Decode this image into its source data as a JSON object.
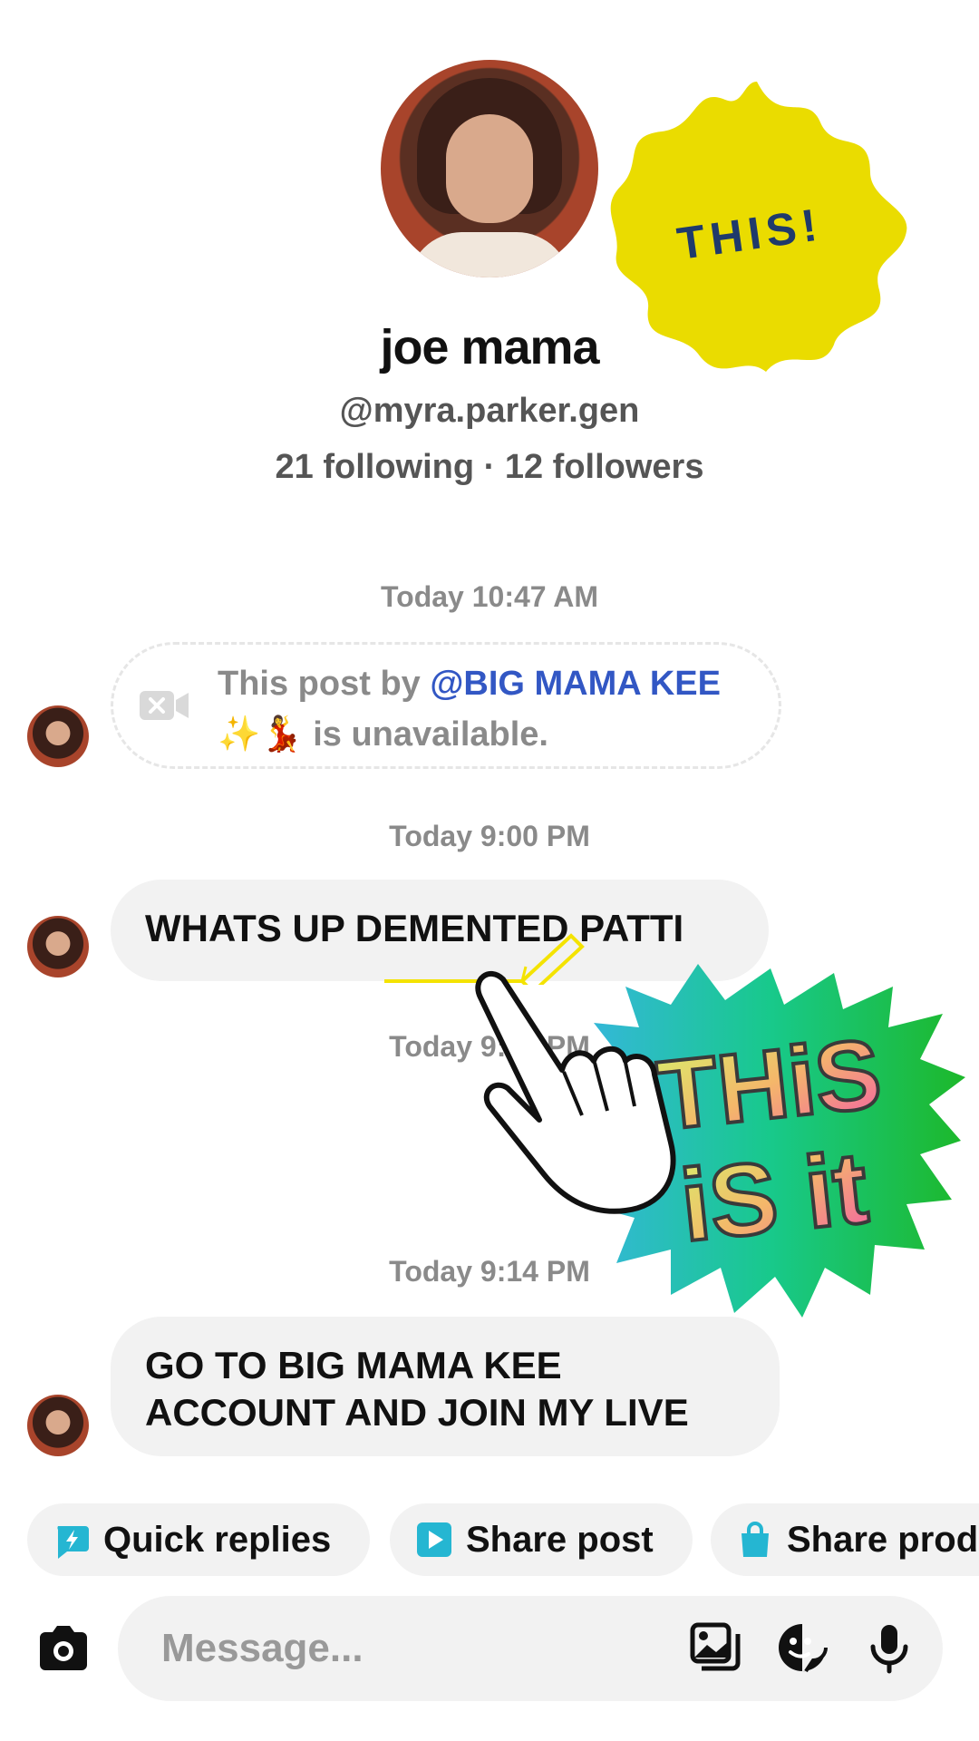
{
  "profile": {
    "name": "joe mama",
    "handle": "@myra.parker.gen",
    "stats": "21 following · 12 followers"
  },
  "stickers": {
    "this": "THIS!",
    "this_is_it_line1": "THiS",
    "this_is_it_line2": "iS it"
  },
  "messages": [
    {
      "timestamp": "Today 10:47 AM",
      "unavailable_prefix": "This post by ",
      "unavailable_mention": "@BIG MAMA KEE",
      "unavailable_emoji": "✨💃",
      "unavailable_suffix": " is unavailable."
    },
    {
      "timestamp": "Today 9:00 PM",
      "text": "WHATS UP DEMENTED PATTI"
    },
    {
      "timestamp": "Today 9:07 PM"
    },
    {
      "timestamp": "Today 9:14 PM",
      "text": "GO TO BIG MAMA KEE ACCOUNT AND JOIN MY LIVE"
    }
  ],
  "quick_actions": [
    {
      "label": "Quick replies",
      "icon": "quick-reply-icon"
    },
    {
      "label": "Share post",
      "icon": "play-icon"
    },
    {
      "label": "Share product",
      "icon": "shopping-bag-icon"
    }
  ],
  "composer": {
    "placeholder": "Message...",
    "icons": [
      "camera-icon",
      "gallery-icon",
      "sticker-icon",
      "microphone-icon"
    ]
  },
  "colors": {
    "mention": "#3257c4",
    "chip_icon": "#25b6d2",
    "bubble": "#f2f2f2",
    "sticker_yellow": "#eadc00"
  }
}
